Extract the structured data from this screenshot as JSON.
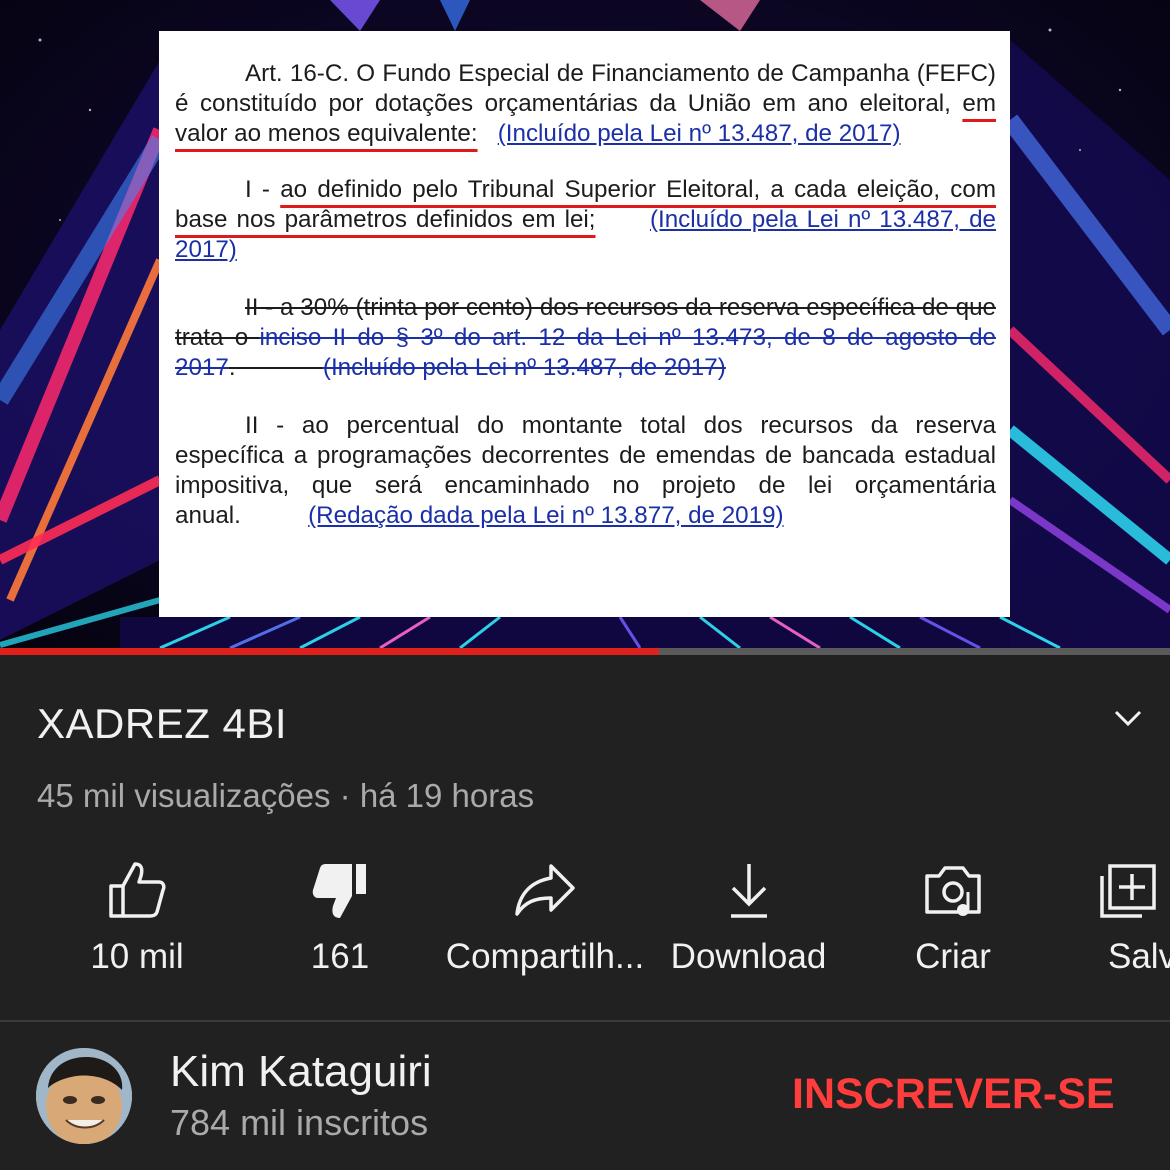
{
  "document": {
    "p1_text": "Art. 16-C. O Fundo Especial de Financiamento de Campanha (FEFC) é constituído por dotações orçamentárias da União em ano eleitoral, ",
    "p1_highlight": "em valor ao menos equivalente:",
    "p1_link": "(Incluído pela Lei nº 13.487, de 2017)",
    "p2_prefix": "I - ",
    "p2_highlight": "ao definido pelo Tribunal Superior Eleitoral, a cada eleição, com base nos parâmetros definidos em lei;",
    "p2_link": "(Incluído pela Lei nº 13.487, de 2017)",
    "p3_text": "II - a 30% (trinta por cento) dos recursos da reserva específica de que trata o ",
    "p3_link1": "inciso II do § 3º do art. 12 da Lei nº 13.473, de 8 de agosto de 2017",
    "p3_link2": "(Incluído pela Lei nº 13.487, de 2017)",
    "p4_text": "II - ao percentual do montante total dos recursos da reserva específica a programações decorrentes de emendas de bancada estadual impositiva, que será encaminhado no projeto de lei orçamentária anual.",
    "p4_link": "(Redação dada pela Lei nº 13.877, de 2019)"
  },
  "progress": {
    "fraction": 0.563,
    "played_color": "#e0201b",
    "track_color": "#5a5a5a"
  },
  "video": {
    "title": "XADREZ 4BI",
    "views": "45 mil visualizações",
    "separator": "·",
    "age": "há 19 horas"
  },
  "actions": {
    "like": {
      "label": "10 mil",
      "icon": "thumbs-up-icon"
    },
    "dislike": {
      "label": "161",
      "icon": "thumbs-down-filled-icon"
    },
    "share": {
      "label": "Compartilh...",
      "icon": "share-arrow-icon"
    },
    "download": {
      "label": "Download",
      "icon": "download-icon"
    },
    "create": {
      "label": "Criar",
      "icon": "camera-music-icon"
    },
    "save": {
      "label": "Salv",
      "icon": "playlist-add-icon"
    }
  },
  "channel": {
    "name": "Kim Kataguiri",
    "subscribers": "784 mil inscritos",
    "subscribe_label": "INSCREVER-SE",
    "subscribe_color": "#ff3d3d"
  }
}
